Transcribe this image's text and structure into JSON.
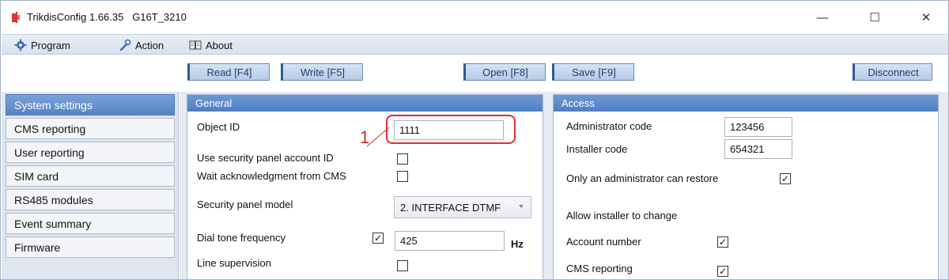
{
  "window": {
    "title": "TrikdisConfig 1.66.35   G16T_3210",
    "min_glyph": "—",
    "max_glyph": "☐",
    "close_glyph": "✕"
  },
  "menu": {
    "program": "Program",
    "action": "Action",
    "about": "About"
  },
  "toolbar": {
    "read": "Read [F4]",
    "write": "Write [F5]",
    "open": "Open [F8]",
    "save": "Save [F9]",
    "disconnect": "Disconnect"
  },
  "nav": {
    "items": [
      "System settings",
      "CMS reporting",
      "User reporting",
      "SIM card",
      "RS485 modules",
      "Event summary",
      "Firmware"
    ],
    "active": "System settings"
  },
  "general": {
    "header": "General",
    "object_id_label": "Object ID",
    "object_id_value": "1111",
    "use_account_label": "Use security panel account ID",
    "use_account_checked": false,
    "wait_ack_label": "Wait acknowledgment from CMS",
    "wait_ack_checked": false,
    "panel_model_label": "Security panel model",
    "panel_model_value": "2. INTERFACE DTMF",
    "dial_tone_label": "Dial tone frequency",
    "dial_tone_checked": true,
    "dial_tone_value": "425",
    "dial_tone_unit": "Hz",
    "line_supervision_label": "Line supervision",
    "line_supervision_checked": false
  },
  "access": {
    "header": "Access",
    "admin_code_label": "Administrator code",
    "admin_code_value": "123456",
    "installer_code_label": "Installer code",
    "installer_code_value": "654321",
    "only_admin_label": "Only an administrator can restore",
    "only_admin_checked": true,
    "allow_installer_label": "Allow installer to change",
    "account_number_label": "Account number",
    "account_number_checked": true,
    "cms_reporting_label": "CMS reporting",
    "cms_reporting_checked": true
  },
  "annotation": {
    "number": "1"
  },
  "colors": {
    "accent": "#5585c6",
    "panel_header": "#4e7fc3",
    "callout": "#e0302c"
  },
  "icons": {
    "app": "trikdis-app-icon",
    "program": "gear-icon",
    "action": "wrench-icon",
    "about": "book-icon"
  }
}
